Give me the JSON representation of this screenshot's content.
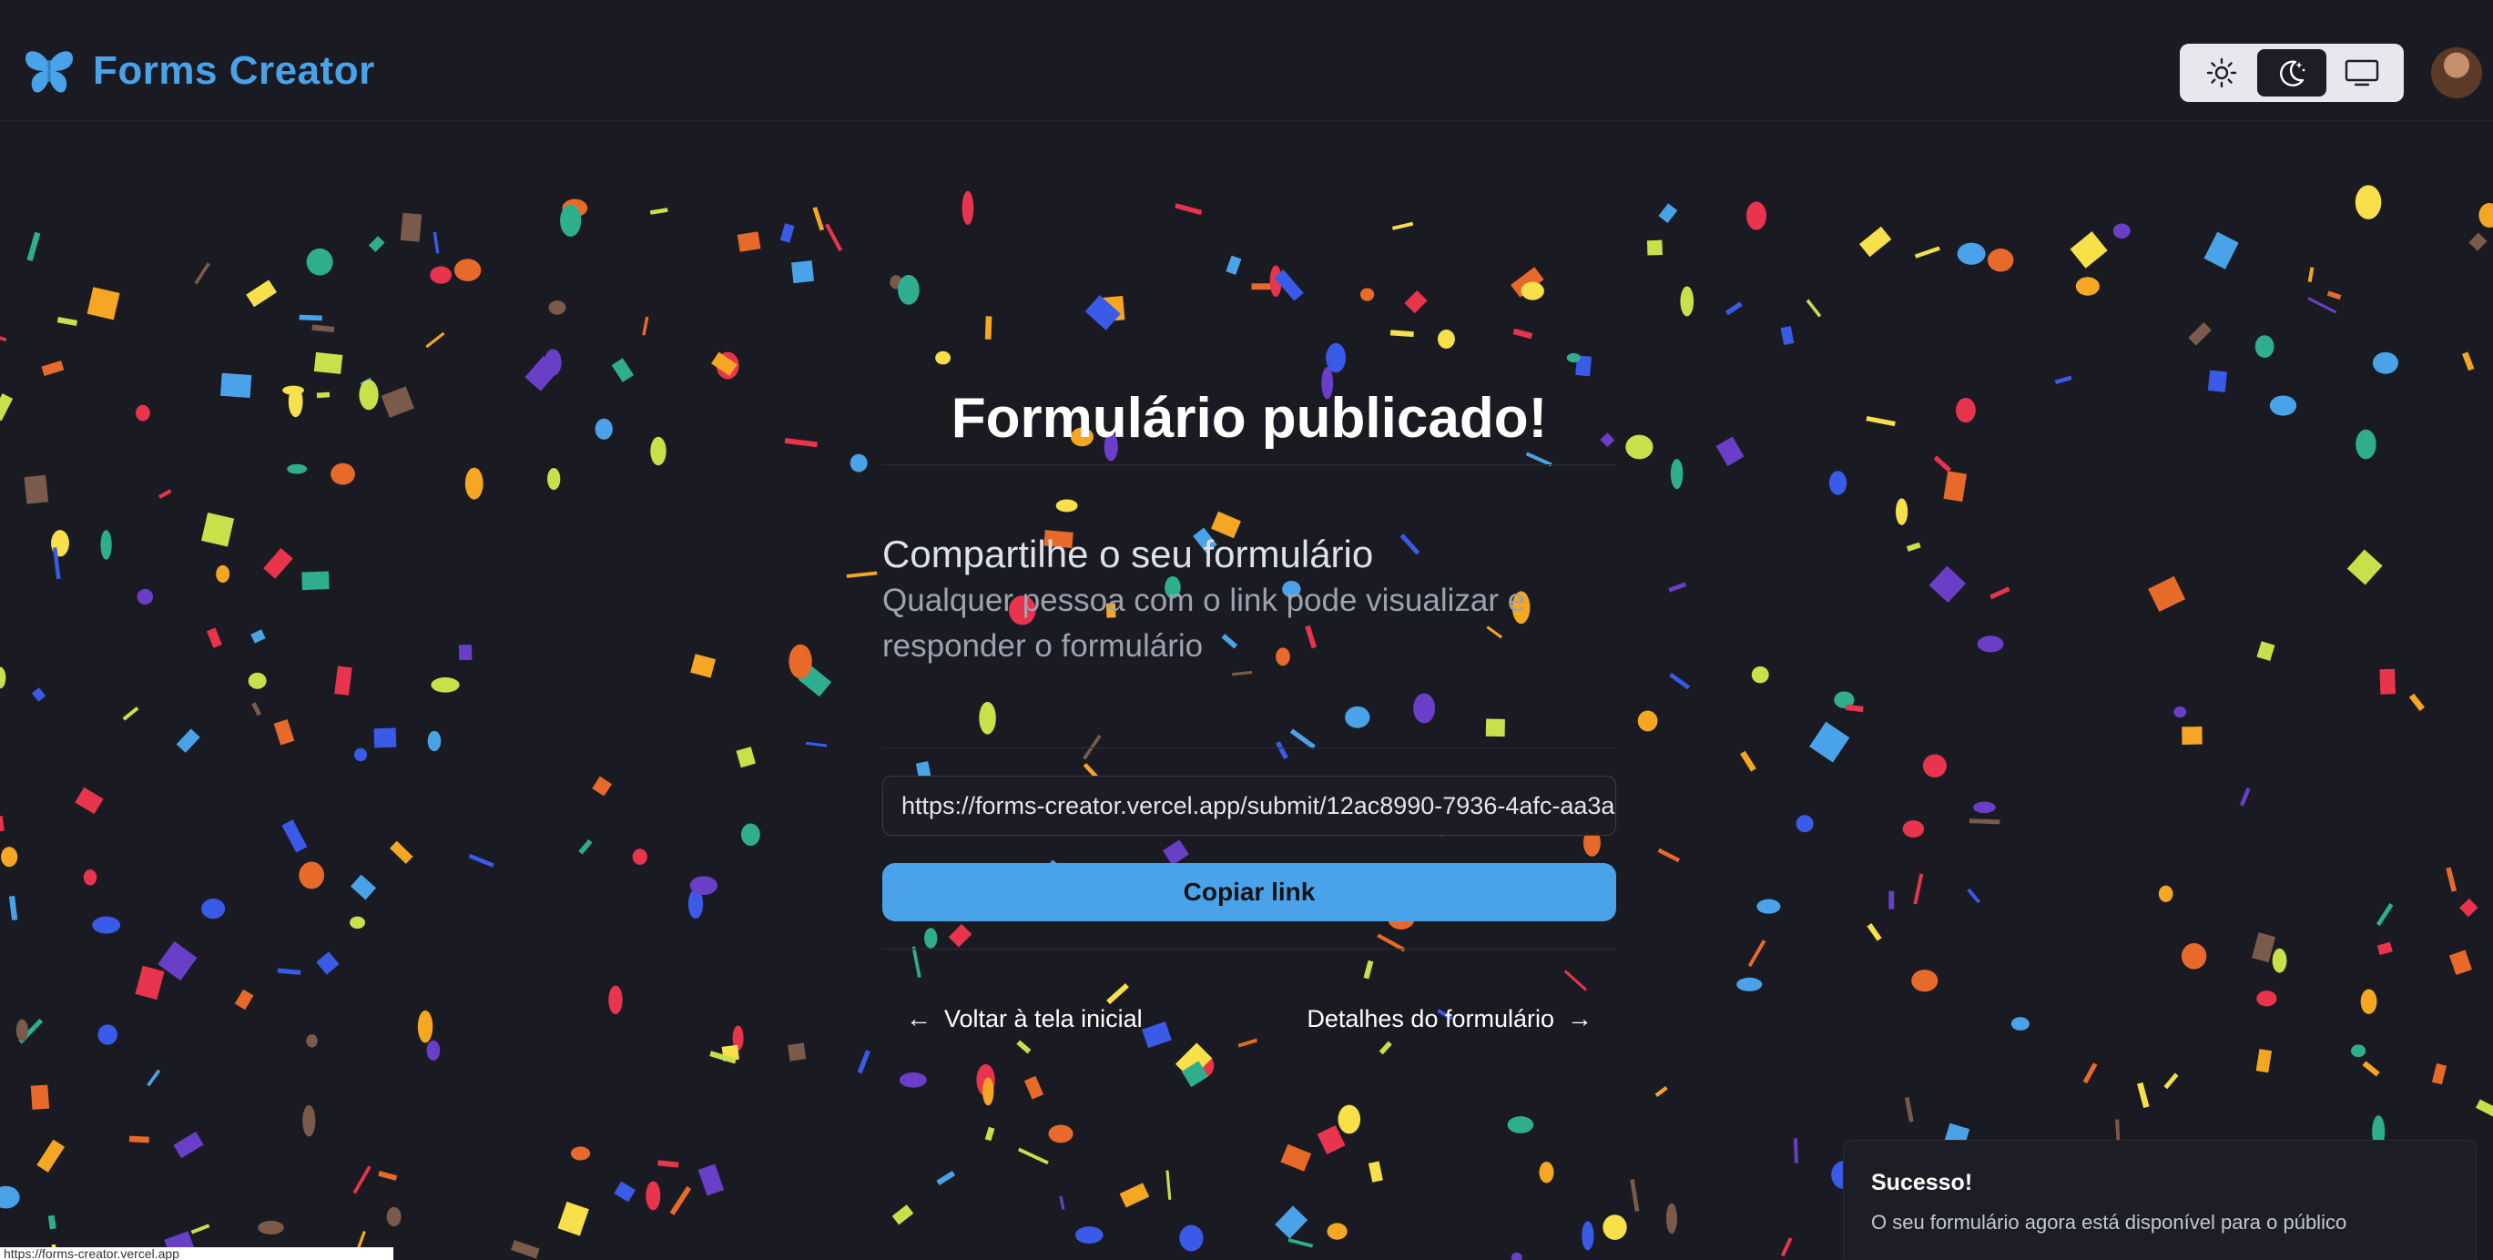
{
  "app": {
    "title": "Forms Creator",
    "logo_icon": "butterfly-icon",
    "brand_color": "#4aa3e8"
  },
  "theme_toggle": {
    "options": [
      {
        "name": "light-theme",
        "icon": "sun-icon",
        "active": false
      },
      {
        "name": "dark-theme",
        "icon": "moon-stars-icon",
        "active": true
      },
      {
        "name": "system-theme",
        "icon": "monitor-icon",
        "active": false
      }
    ]
  },
  "main": {
    "headline": "Formulário publicado!",
    "share_title": "Compartilhe o seu formulário",
    "share_description": "Qualquer pessoa com o link pode visualizar e responder o formulário",
    "link_value": "https://forms-creator.vercel.app/submit/12ac8990-7936-4afc-aa3a-",
    "copy_button": "Copiar link",
    "back_link": "Voltar à tela inicial",
    "details_link": "Detalhes do formulário"
  },
  "toast": {
    "title": "Sucesso!",
    "message": "O seu formulário agora está disponível para o público"
  },
  "status_bar": {
    "url": "https://forms-creator.vercel.app"
  },
  "colors": {
    "background": "#1a1b22",
    "accent": "#4aa3e8",
    "confetti": [
      "#f5a623",
      "#e8344d",
      "#4aa3e8",
      "#f7e04a",
      "#2fae8f",
      "#6a3fc8",
      "#e86a2a",
      "#c8e04a",
      "#7a5a4a",
      "#3a5ae8"
    ]
  }
}
